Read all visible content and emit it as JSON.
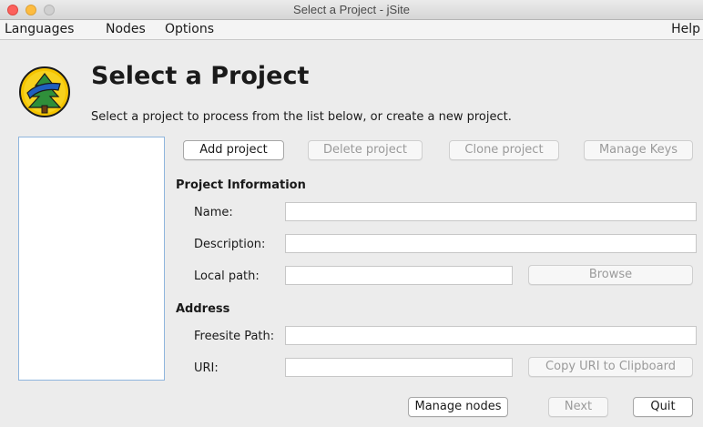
{
  "window": {
    "title": "Select a Project - jSite"
  },
  "menubar": {
    "languages": "Languages",
    "nodes": "Nodes",
    "options": "Options",
    "help": "Help"
  },
  "header": {
    "title": "Select a Project",
    "subtitle": "Select a project to process from the list below, or create a new project."
  },
  "toolbar": {
    "add_project": "Add project",
    "delete_project": "Delete project",
    "clone_project": "Clone project",
    "manage_keys": "Manage Keys"
  },
  "project_information": {
    "heading": "Project Information",
    "name_label": "Name:",
    "name_value": "",
    "description_label": "Description:",
    "description_value": "",
    "local_path_label": "Local path:",
    "local_path_value": "",
    "browse": "Browse"
  },
  "address": {
    "heading": "Address",
    "freesite_path_label": "Freesite Path:",
    "freesite_path_value": "",
    "uri_label": "URI:",
    "uri_value": "",
    "copy_uri": "Copy URI to Clipboard"
  },
  "footer": {
    "manage_nodes": "Manage nodes",
    "next": "Next",
    "quit": "Quit"
  },
  "colors": {
    "list_border": "#8fb5dd",
    "close": "#fc605c",
    "minimize": "#fdbc40",
    "logo_yellow": "#f5c400",
    "logo_blue": "#1f5fbf",
    "logo_green": "#2f8f3a"
  }
}
